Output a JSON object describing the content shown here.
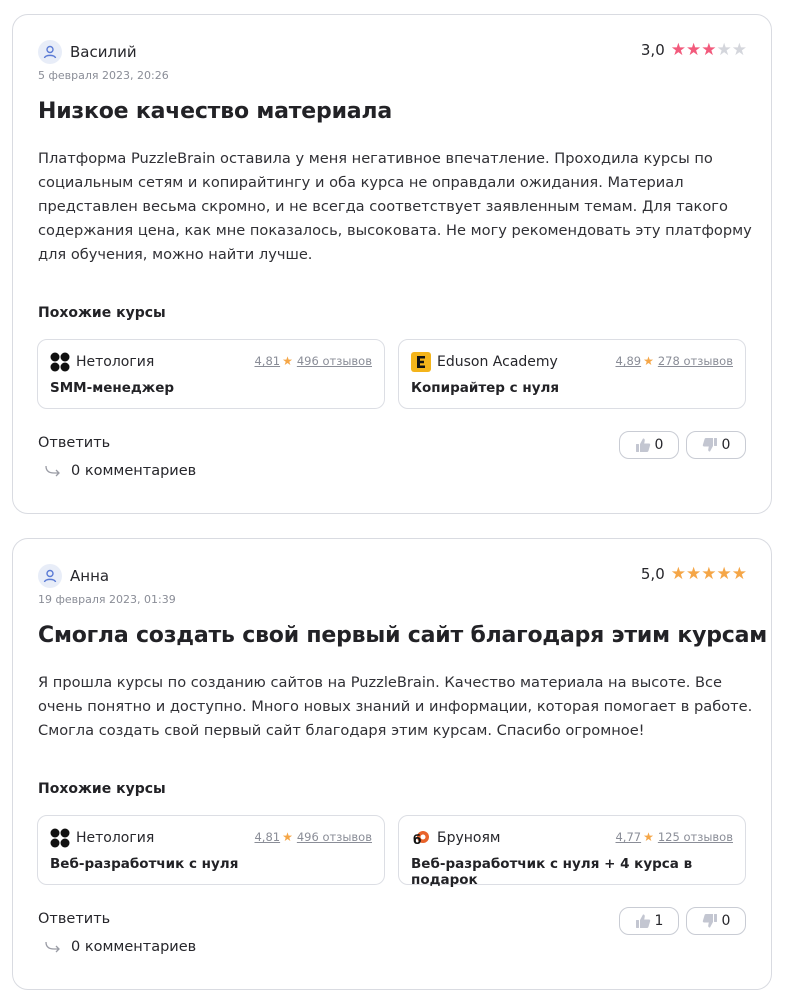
{
  "reviews": [
    {
      "author": "Василий",
      "date": "5 февраля 2023, 20:26",
      "rating_value": "3,0",
      "stars_filled": 3,
      "star_color": "#f25a7c",
      "title": "Низкое качество материала",
      "text": "Платформа PuzzleBrain оставила у меня негативное впечатление. Проходила курсы по социальным сетям и копирайтингу и оба курса не оправдали ожидания. Материал представлен весьма скромно, и не всегда соответствует заявленным темам. Для такого содержания цена, как мне показалось, высоковата. Не могу рекомендовать эту платформу для обучения, можно найти лучше.",
      "similar_label": "Похожие курсы",
      "courses": [
        {
          "school": "Нетология",
          "logo": "netology-logo",
          "rating": "4,81",
          "reviews": "496 отзывов",
          "name": "SMM-менеджер"
        },
        {
          "school": "Eduson Academy",
          "logo": "eduson-logo",
          "rating": "4,89",
          "reviews": "278 отзывов",
          "name": "Копирайтер с нуля"
        }
      ],
      "reply_label": "Ответить",
      "comments_label": "0 комментариев",
      "likes": "0",
      "dislikes": "0"
    },
    {
      "author": "Анна",
      "date": "19 февраля 2023, 01:39",
      "rating_value": "5,0",
      "stars_filled": 5,
      "star_color": "#f5a647",
      "title": "Смогла создать свой первый сайт благодаря этим курсам",
      "text": "Я прошла курсы по созданию сайтов на PuzzleBrain. Качество материала на высоте. Все очень понятно и доступно. Много новых знаний и информации, которая помогает в работе. Смогла создать свой первый сайт благодаря этим курсам. Спасибо огромное!",
      "similar_label": "Похожие курсы",
      "courses": [
        {
          "school": "Нетология",
          "logo": "netology-logo",
          "rating": "4,81",
          "reviews": "496 отзывов",
          "name": "Веб-разработчик с нуля"
        },
        {
          "school": "Бруноям",
          "logo": "brunoyam-logo",
          "rating": "4,77",
          "reviews": "125 отзывов",
          "name": "Веб-разработчик с нуля + 4 курса в подарок"
        }
      ],
      "reply_label": "Ответить",
      "comments_label": "0 комментариев",
      "likes": "1",
      "dislikes": "0"
    }
  ]
}
